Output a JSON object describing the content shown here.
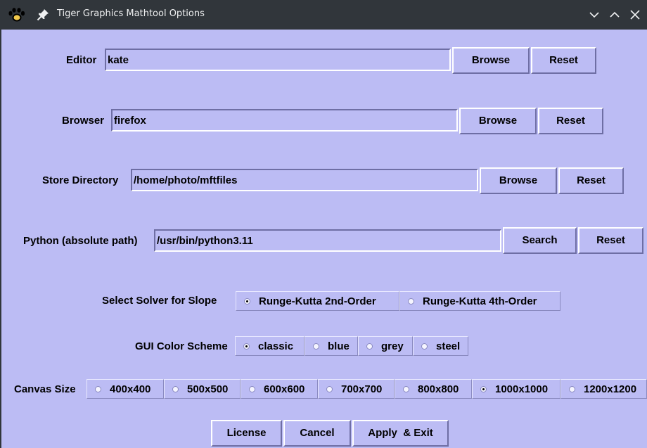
{
  "window": {
    "title": "Tiger Graphics Mathtool Options",
    "icons": [
      "paw-icon",
      "pin-icon",
      "minimize-icon",
      "maximize-icon",
      "close-icon"
    ]
  },
  "editor": {
    "label": "Editor",
    "value": "kate",
    "browse": "Browse",
    "reset": "Reset"
  },
  "browser": {
    "label": "Browser",
    "value": "firefox",
    "browse": "Browse",
    "reset": "Reset"
  },
  "store": {
    "label": "Store Directory",
    "value": "/home/photo/mftfiles",
    "browse": "Browse",
    "reset": "Reset"
  },
  "python": {
    "label": "Python (absolute path)",
    "value": "/usr/bin/python3.11",
    "search": "Search",
    "reset": "Reset"
  },
  "solver": {
    "label": "Select Solver for Slope",
    "options": [
      "Runge-Kutta 2nd-Order",
      "Runge-Kutta 4th-Order"
    ],
    "selected": "Runge-Kutta 2nd-Order"
  },
  "color_scheme": {
    "label": "GUI Color Scheme",
    "options": [
      "classic",
      "blue",
      "grey",
      "steel"
    ],
    "selected": "classic"
  },
  "canvas_size": {
    "label": "Canvas Size",
    "options": [
      "400x400",
      "500x500",
      "600x600",
      "700x700",
      "800x800",
      "1000x1000",
      "1200x1200"
    ],
    "selected": "1000x1000"
  },
  "footer": {
    "license": "License",
    "cancel": "Cancel",
    "apply_exit": "Apply  & Exit"
  },
  "colors": {
    "background": "#bcbcf4",
    "titlebar": "#31363b"
  }
}
